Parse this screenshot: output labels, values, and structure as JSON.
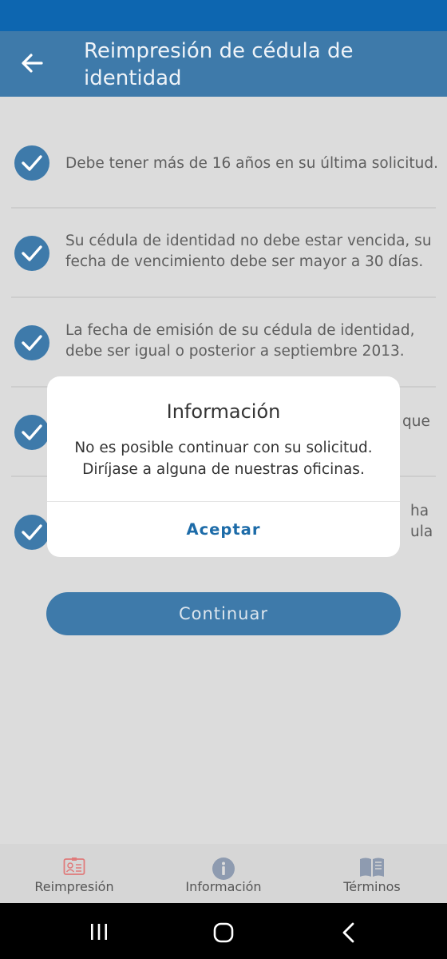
{
  "app_bar": {
    "title": "Reimpresión de cédula de identidad"
  },
  "requirements": [
    {
      "text": "Debe tener más de 16 años en su última solicitud."
    },
    {
      "text": "Su cédula de identidad no debe estar vencida, su fecha de vencimiento debe ser mayor a 30 días."
    },
    {
      "text": "La fecha de emisión de su cédula de identidad, debe ser igual o posterior a septiembre 2013."
    },
    {
      "text": "que"
    },
    {
      "text": "ha ula"
    }
  ],
  "continue_label": "Continuar",
  "dialog": {
    "title": "Información",
    "message_line1": "No es posible continuar con su solicitud.",
    "message_line2": "Diríjase a alguna de nuestras oficinas.",
    "accept_label": "Aceptar"
  },
  "bottom_nav": [
    {
      "label": "Reimpresión",
      "icon": "id-card-icon",
      "color": "#e07a7a"
    },
    {
      "label": "Información",
      "icon": "info-icon",
      "color": "#8e9bb0"
    },
    {
      "label": "Términos",
      "icon": "book-icon",
      "color": "#8e9bb0"
    }
  ],
  "colors": {
    "status_bar": "#0d66b0",
    "app_bar": "#3e7aaa",
    "accent": "#1c6ba8"
  }
}
